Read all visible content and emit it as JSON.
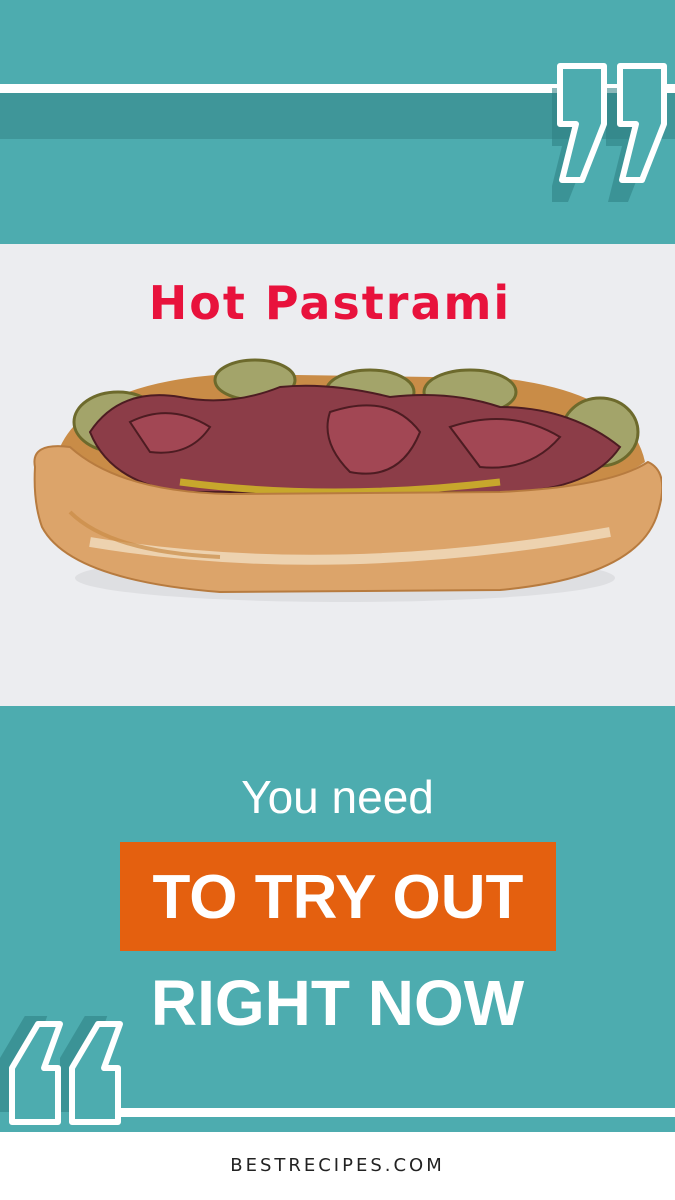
{
  "title": "Hot Pastrami",
  "lead": "You need",
  "highlight": "TO TRY OUT",
  "headline": "RIGHT NOW",
  "footer": "BESTRECIPES.COM",
  "colors": {
    "teal": "#4dacaf",
    "teal_dark": "#3f9699",
    "title_red": "#e8123c",
    "highlight_orange": "#e4600f",
    "photo_bg": "#ecedf0"
  },
  "icons": {
    "top_right": "closing-quote-icon",
    "bottom_left": "opening-quote-icon",
    "photo": "pastrami-sandwich-image"
  }
}
